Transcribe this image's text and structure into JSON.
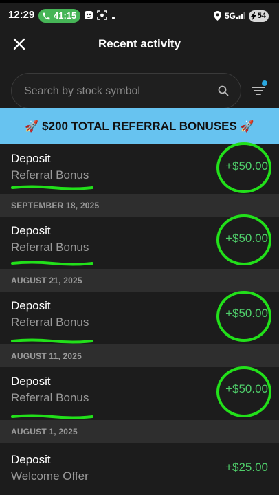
{
  "status_bar": {
    "time": "12:29",
    "call_timer": "41:15",
    "network": "5G",
    "battery": "54"
  },
  "header": {
    "title": "Recent activity"
  },
  "search": {
    "placeholder": "Search by stock symbol",
    "value": ""
  },
  "banner": {
    "emphasis": "$200 TOTAL",
    "text": "REFERRAL BONUSES"
  },
  "activities": [
    {
      "name": "Deposit",
      "description": "Referral Bonus",
      "amount": "+$50.00"
    },
    {
      "name": "Deposit",
      "description": "Referral Bonus",
      "amount": "+$50.00"
    },
    {
      "name": "Deposit",
      "description": "Referral Bonus",
      "amount": "+$50.00"
    },
    {
      "name": "Deposit",
      "description": "Referral Bonus",
      "amount": "+$50.00"
    },
    {
      "name": "Deposit",
      "description": "Welcome Offer",
      "amount": "+$25.00"
    }
  ],
  "dates": [
    "SEPTEMBER 18, 2025",
    "AUGUST 21, 2025",
    "AUGUST 11, 2025",
    "AUGUST 1, 2025"
  ],
  "colors": {
    "background": "#1c1c1c",
    "banner": "#67c3f0",
    "amount_green": "#4fce6a",
    "annotation_green": "#22e01a",
    "call_pill": "#46b557"
  },
  "icons": [
    "close-icon",
    "search-icon",
    "filter-icon",
    "rocket-icon",
    "phone-icon",
    "location-icon",
    "signal-icon"
  ]
}
